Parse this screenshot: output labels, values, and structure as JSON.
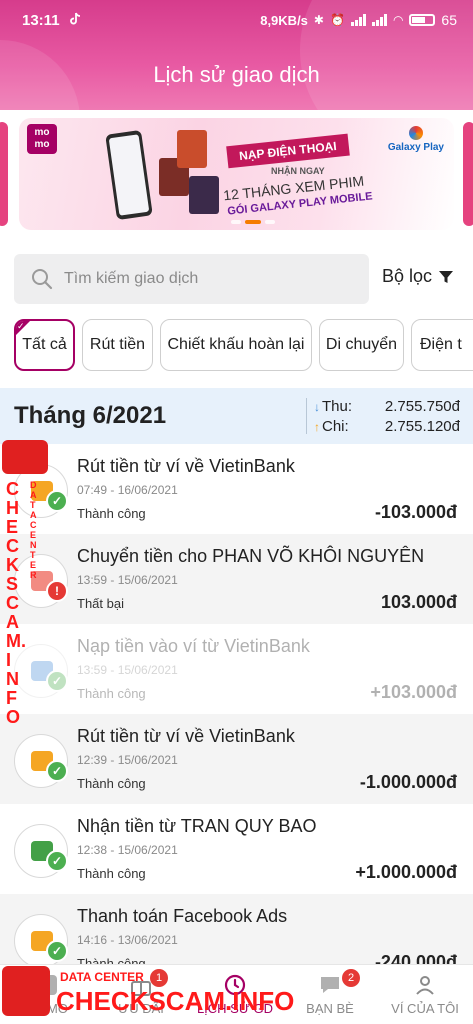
{
  "status_bar": {
    "time": "13:11",
    "speed": "8,9KB/s",
    "battery": "65"
  },
  "header": {
    "title": "Lịch sử giao dịch"
  },
  "banner": {
    "brand": "mo mo",
    "ribbon": "NẠP ĐIỆN THOẠI",
    "line1": "NHẬN NGAY",
    "line2": "12 THÁNG XEM PHIM",
    "line3": "GÓI GALAXY PLAY MOBILE",
    "partner": "Galaxy Play"
  },
  "search": {
    "placeholder": "Tìm kiếm giao dịch",
    "filter_label": "Bộ lọc"
  },
  "chips": [
    {
      "label": "Tất cả",
      "active": true
    },
    {
      "label": "Rút tiền",
      "active": false
    },
    {
      "label": "Chiết khấu hoàn lại",
      "active": false
    },
    {
      "label": "Di chuyển",
      "active": false
    },
    {
      "label": "Điện t",
      "active": false
    }
  ],
  "summary": {
    "month": "Tháng 6/2021",
    "income_label": "Thu:",
    "income": "2.755.750đ",
    "expense_label": "Chi:",
    "expense": "2.755.120đ"
  },
  "transactions": [
    {
      "name": "Rút tiền từ ví về VietinBank",
      "date": "07:49 - 16/06/2021",
      "status": "Thành công",
      "amount": "-103.000đ",
      "state": "ok",
      "icon": "atm-withdraw-icon",
      "icon_color": "#f5a623"
    },
    {
      "name": "Chuyển tiền cho PHAN VÕ KHÔI NGUYÊN",
      "date": "13:59 - 15/06/2021",
      "status": "Thất bại",
      "amount": "103.000đ",
      "state": "fail",
      "icon": "transfer-icon",
      "icon_color": "#f28b82"
    },
    {
      "name": "Nạp tiền vào ví từ VietinBank",
      "date": "13:59 - 15/06/2021",
      "status": "Thành công",
      "amount": "+103.000đ",
      "state": "ok",
      "icon": "wallet-topup-icon",
      "icon_color": "#4a90d9"
    },
    {
      "name": "Rút tiền từ ví về VietinBank",
      "date": "12:39 - 15/06/2021",
      "status": "Thành công",
      "amount": "-1.000.000đ",
      "state": "ok",
      "icon": "atm-withdraw-icon",
      "icon_color": "#f5a623"
    },
    {
      "name": "Nhận tiền từ TRAN QUY BAO",
      "date": "12:38 - 15/06/2021",
      "status": "Thành công",
      "amount": "+1.000.000đ",
      "state": "ok",
      "icon": "receive-money-icon",
      "icon_color": "#43a047"
    },
    {
      "name": "Thanh toán Facebook Ads",
      "date": "14:16 - 13/06/2021",
      "status": "Thành công",
      "amount": "-240.000đ",
      "state": "ok",
      "icon": "payment-icon",
      "icon_color": "#f5a623"
    }
  ],
  "nav": [
    {
      "label": "MOMO",
      "icon": "momo-home-icon",
      "badge": ""
    },
    {
      "label": "ƯU ĐÃI",
      "icon": "gift-icon",
      "badge": "1"
    },
    {
      "label": "LỊCH SỬ GD",
      "icon": "history-icon",
      "badge": "",
      "active": true
    },
    {
      "label": "BẠN BÈ",
      "icon": "chat-icon",
      "badge": "2"
    },
    {
      "label": "VÍ CỦA TÔI",
      "icon": "profile-icon",
      "badge": ""
    }
  ],
  "watermark": {
    "vertical": "CHECKSCAM.INFO",
    "vertical_small": "DATA CENTER",
    "bottom": "CHECKSCAM.INFO",
    "bottom_small": "DATA CENTER"
  },
  "colors": {
    "brand": "#a50064",
    "header": "#e14f9c",
    "success": "#4caf50",
    "fail": "#e53935",
    "summary_bg": "#e7f1fb"
  }
}
